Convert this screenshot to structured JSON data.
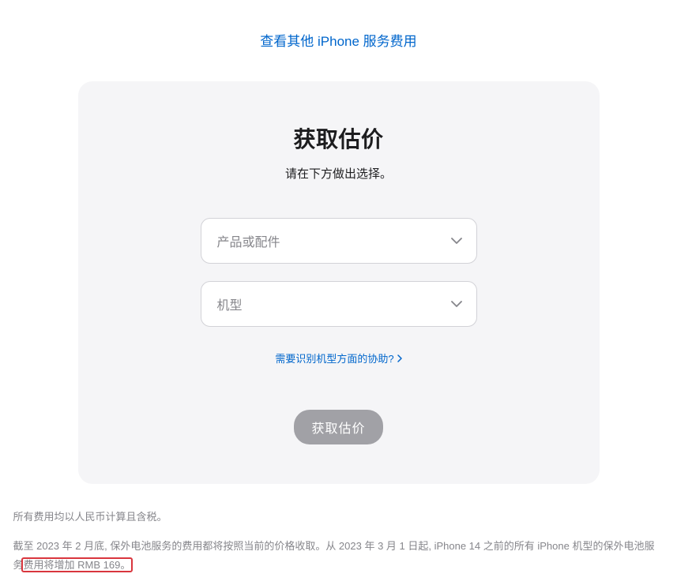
{
  "topLink": "查看其他 iPhone 服务费用",
  "card": {
    "title": "获取估价",
    "subtitle": "请在下方做出选择。",
    "select1": {
      "placeholder": "产品或配件"
    },
    "select2": {
      "placeholder": "机型"
    },
    "helpLink": "需要识别机型方面的协助?",
    "button": "获取估价"
  },
  "foot": {
    "p1": "所有费用均以人民币计算且含税。",
    "p2a": "截至 2023 年 2 月底, 保外电池服务的费用都将按照当前的价格收取。从 2023 年 3 月 1 日起, iPhone 14 之前的所有 iPhone 机型的保外电池服务",
    "p2b": "费用将增加 RMB 169。"
  }
}
